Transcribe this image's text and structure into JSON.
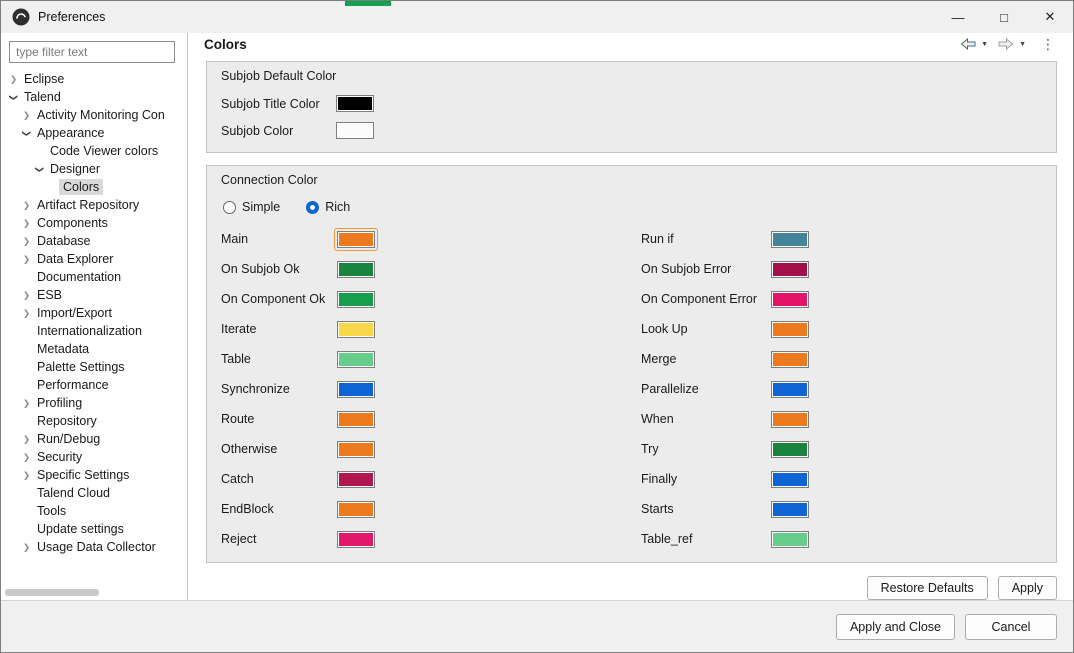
{
  "window": {
    "title": "Preferences",
    "icons": {
      "minimize": "—",
      "maximize": "□",
      "close": "✕",
      "chevron": "❯",
      "kebab": "⋮",
      "back_caret": "▼",
      "forward_caret": "▼"
    }
  },
  "sidebar": {
    "filter_placeholder": "type filter text",
    "tree": [
      {
        "label": "Eclipse",
        "level": 0,
        "state": "collapsed"
      },
      {
        "label": "Talend",
        "level": 0,
        "state": "expanded"
      },
      {
        "label": "Activity Monitoring Con",
        "level": 1,
        "state": "collapsed"
      },
      {
        "label": "Appearance",
        "level": 1,
        "state": "expanded"
      },
      {
        "label": "Code Viewer colors",
        "level": 2,
        "state": "leaf"
      },
      {
        "label": "Designer",
        "level": 2,
        "state": "expanded"
      },
      {
        "label": "Colors",
        "level": 3,
        "state": "leaf",
        "selected": true
      },
      {
        "label": "Artifact Repository",
        "level": 1,
        "state": "collapsed"
      },
      {
        "label": "Components",
        "level": 1,
        "state": "collapsed"
      },
      {
        "label": "Database",
        "level": 1,
        "state": "collapsed"
      },
      {
        "label": "Data Explorer",
        "level": 1,
        "state": "collapsed"
      },
      {
        "label": "Documentation",
        "level": 1,
        "state": "leaf"
      },
      {
        "label": "ESB",
        "level": 1,
        "state": "collapsed"
      },
      {
        "label": "Import/Export",
        "level": 1,
        "state": "collapsed"
      },
      {
        "label": "Internationalization",
        "level": 1,
        "state": "leaf"
      },
      {
        "label": "Metadata",
        "level": 1,
        "state": "leaf"
      },
      {
        "label": "Palette Settings",
        "level": 1,
        "state": "leaf"
      },
      {
        "label": "Performance",
        "level": 1,
        "state": "leaf"
      },
      {
        "label": "Profiling",
        "level": 1,
        "state": "collapsed"
      },
      {
        "label": "Repository",
        "level": 1,
        "state": "leaf"
      },
      {
        "label": "Run/Debug",
        "level": 1,
        "state": "collapsed"
      },
      {
        "label": "Security",
        "level": 1,
        "state": "collapsed"
      },
      {
        "label": "Specific Settings",
        "level": 1,
        "state": "collapsed"
      },
      {
        "label": "Talend Cloud",
        "level": 1,
        "state": "leaf"
      },
      {
        "label": "Tools",
        "level": 1,
        "state": "leaf"
      },
      {
        "label": "Update settings",
        "level": 1,
        "state": "leaf"
      },
      {
        "label": "Usage Data Collector",
        "level": 1,
        "state": "collapsed"
      }
    ]
  },
  "main": {
    "title": "Colors"
  },
  "subjob_group": {
    "title": "Subjob Default Color",
    "rows": [
      {
        "label": "Subjob Title Color",
        "color": "#000000"
      },
      {
        "label": "Subjob Color",
        "color": "#fbfbfb"
      }
    ]
  },
  "connection_group": {
    "title": "Connection Color",
    "options": [
      {
        "label": "Simple",
        "selected": false
      },
      {
        "label": "Rich",
        "selected": true
      }
    ],
    "left_rows": [
      {
        "label": "Main",
        "color": "#EE7A20",
        "focused": true
      },
      {
        "label": "On Subjob Ok",
        "color": "#18843D"
      },
      {
        "label": "On Component Ok",
        "color": "#169E4C"
      },
      {
        "label": "Iterate",
        "color": "#F8D848"
      },
      {
        "label": "Table",
        "color": "#67CD8B"
      },
      {
        "label": "Synchronize",
        "color": "#0E64D2"
      },
      {
        "label": "Route",
        "color": "#EE7A20"
      },
      {
        "label": "Otherwise",
        "color": "#EE7A20"
      },
      {
        "label": "Catch",
        "color": "#B0164F"
      },
      {
        "label": "EndBlock",
        "color": "#EE7A20"
      },
      {
        "label": "Reject",
        "color": "#E2196B"
      }
    ],
    "right_rows": [
      {
        "label": "Run if",
        "color": "#43849B"
      },
      {
        "label": "On Subjob Error",
        "color": "#A31049"
      },
      {
        "label": "On Component Error",
        "color": "#E31566"
      },
      {
        "label": "Look Up",
        "color": "#EE7A20"
      },
      {
        "label": "Merge",
        "color": "#EE7A20"
      },
      {
        "label": "Parallelize",
        "color": "#0E64D2"
      },
      {
        "label": "When",
        "color": "#EE7A20"
      },
      {
        "label": "Try",
        "color": "#18843D"
      },
      {
        "label": "Finally",
        "color": "#0E64D2"
      },
      {
        "label": "Starts",
        "color": "#0E64D2"
      },
      {
        "label": "Table_ref",
        "color": "#67CD8B"
      }
    ]
  },
  "actions": {
    "restore_defaults": "Restore Defaults",
    "apply": "Apply",
    "apply_and_close": "Apply and Close",
    "cancel": "Cancel"
  }
}
